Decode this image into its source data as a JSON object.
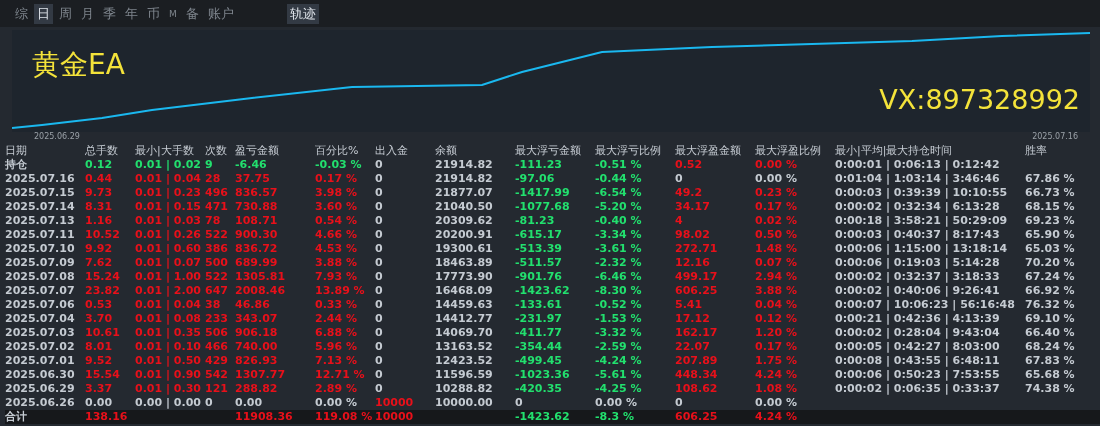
{
  "period_tabs": [
    {
      "label": "综",
      "selected": false
    },
    {
      "label": "日",
      "selected": true
    },
    {
      "label": "周",
      "selected": false
    },
    {
      "label": "月",
      "selected": false
    },
    {
      "label": "季",
      "selected": false
    },
    {
      "label": "年",
      "selected": false
    },
    {
      "label": "币",
      "selected": false
    },
    {
      "label": "M",
      "selected": false
    },
    {
      "label": "备",
      "selected": false
    },
    {
      "label": "账户",
      "selected": false
    }
  ],
  "view_tabs": [
    {
      "label": "轨迹",
      "selected": true
    }
  ],
  "chart": {
    "title": "黄金EA",
    "contact": "VX:897328992",
    "start_date": "2025.06.29",
    "end_date": "2025.07.16"
  },
  "table": {
    "columns": [
      "日期",
      "总手数",
      "最小|大手数",
      "次数",
      "盈亏金额",
      "百分比%",
      "出入金",
      "余额",
      "最大浮亏金额",
      "最大浮亏比例",
      "最大浮盈金额",
      "最大浮盈比例",
      "最小|平均|最大持仓时间",
      "胜率"
    ],
    "rows": [
      {
        "kind": "open",
        "cells": [
          {
            "text": "持仓",
            "color": "#c5cbd2"
          },
          {
            "text": "0.12",
            "color": "#22e06e"
          },
          {
            "text": "0.01 | 0.02",
            "color": "#22e06e"
          },
          {
            "text": "9",
            "color": "#22e06e"
          },
          {
            "text": "-6.46",
            "color": "#22e06e"
          },
          {
            "text": "-0.03 %",
            "color": "#22e06e"
          },
          {
            "text": "0",
            "color": "#c5cbd2"
          },
          {
            "text": "21914.82",
            "color": "#c5cbd2"
          },
          {
            "text": "-111.23",
            "color": "#22e06e"
          },
          {
            "text": "-0.51 %",
            "color": "#22e06e"
          },
          {
            "text": "0.52",
            "color": "#e8101a"
          },
          {
            "text": "0.00 %",
            "color": "#e8101a"
          },
          {
            "text": "0:00:01 | 0:06:13 | 0:12:42",
            "color": "#c5cbd2"
          }
        ]
      },
      {
        "kind": "day",
        "cells": [
          {
            "text": "2025.07.16",
            "color": "#c5cbd2"
          },
          {
            "text": "0.44",
            "color": "#e8101a"
          },
          {
            "text": "0.01 | 0.04",
            "color": "#e8101a"
          },
          {
            "text": "28",
            "color": "#e8101a"
          },
          {
            "text": "37.75",
            "color": "#e8101a"
          },
          {
            "text": "0.17 %",
            "color": "#e8101a"
          },
          {
            "text": "0",
            "color": "#c5cbd2"
          },
          {
            "text": "21914.82",
            "color": "#c5cbd2"
          },
          {
            "text": "-97.06",
            "color": "#22e06e"
          },
          {
            "text": "-0.44 %",
            "color": "#22e06e"
          },
          {
            "text": "0",
            "color": "#c5cbd2"
          },
          {
            "text": "0.00 %",
            "color": "#c5cbd2"
          },
          {
            "text": "0:01:04 | 1:03:14 | 3:46:46",
            "color": "#c5cbd2"
          },
          {
            "text": "67.86 %",
            "color": "#c5cbd2"
          }
        ]
      },
      {
        "kind": "day",
        "cells": [
          {
            "text": "2025.07.15",
            "color": "#c5cbd2"
          },
          {
            "text": "9.73",
            "color": "#e8101a"
          },
          {
            "text": "0.01 | 0.23",
            "color": "#e8101a"
          },
          {
            "text": "496",
            "color": "#e8101a"
          },
          {
            "text": "836.57",
            "color": "#e8101a"
          },
          {
            "text": "3.98 %",
            "color": "#e8101a"
          },
          {
            "text": "0",
            "color": "#c5cbd2"
          },
          {
            "text": "21877.07",
            "color": "#c5cbd2"
          },
          {
            "text": "-1417.99",
            "color": "#22e06e"
          },
          {
            "text": "-6.54 %",
            "color": "#22e06e"
          },
          {
            "text": "49.2",
            "color": "#e8101a"
          },
          {
            "text": "0.23 %",
            "color": "#e8101a"
          },
          {
            "text": "0:00:03 | 0:39:39 | 10:10:55",
            "color": "#c5cbd2"
          },
          {
            "text": "66.73 %",
            "color": "#c5cbd2"
          }
        ]
      },
      {
        "kind": "day",
        "cells": [
          {
            "text": "2025.07.14",
            "color": "#c5cbd2"
          },
          {
            "text": "8.31",
            "color": "#e8101a"
          },
          {
            "text": "0.01 | 0.15",
            "color": "#e8101a"
          },
          {
            "text": "471",
            "color": "#e8101a"
          },
          {
            "text": "730.88",
            "color": "#e8101a"
          },
          {
            "text": "3.60 %",
            "color": "#e8101a"
          },
          {
            "text": "0",
            "color": "#c5cbd2"
          },
          {
            "text": "21040.50",
            "color": "#c5cbd2"
          },
          {
            "text": "-1077.68",
            "color": "#22e06e"
          },
          {
            "text": "-5.20 %",
            "color": "#22e06e"
          },
          {
            "text": "34.17",
            "color": "#e8101a"
          },
          {
            "text": "0.17 %",
            "color": "#e8101a"
          },
          {
            "text": "0:00:02 | 0:32:34 | 6:13:28",
            "color": "#c5cbd2"
          },
          {
            "text": "68.15 %",
            "color": "#c5cbd2"
          }
        ]
      },
      {
        "kind": "day",
        "cells": [
          {
            "text": "2025.07.13",
            "color": "#c5cbd2"
          },
          {
            "text": "1.16",
            "color": "#e8101a"
          },
          {
            "text": "0.01 | 0.03",
            "color": "#e8101a"
          },
          {
            "text": "78",
            "color": "#e8101a"
          },
          {
            "text": "108.71",
            "color": "#e8101a"
          },
          {
            "text": "0.54 %",
            "color": "#e8101a"
          },
          {
            "text": "0",
            "color": "#c5cbd2"
          },
          {
            "text": "20309.62",
            "color": "#c5cbd2"
          },
          {
            "text": "-81.23",
            "color": "#22e06e"
          },
          {
            "text": "-0.40 %",
            "color": "#22e06e"
          },
          {
            "text": "4",
            "color": "#e8101a"
          },
          {
            "text": "0.02 %",
            "color": "#e8101a"
          },
          {
            "text": "0:00:18 | 3:58:21 | 50:29:09",
            "color": "#c5cbd2"
          },
          {
            "text": "69.23 %",
            "color": "#c5cbd2"
          }
        ]
      },
      {
        "kind": "day",
        "cells": [
          {
            "text": "2025.07.11",
            "color": "#c5cbd2"
          },
          {
            "text": "10.52",
            "color": "#e8101a"
          },
          {
            "text": "0.01 | 0.26",
            "color": "#e8101a"
          },
          {
            "text": "522",
            "color": "#e8101a"
          },
          {
            "text": "900.30",
            "color": "#e8101a"
          },
          {
            "text": "4.66 %",
            "color": "#e8101a"
          },
          {
            "text": "0",
            "color": "#c5cbd2"
          },
          {
            "text": "20200.91",
            "color": "#c5cbd2"
          },
          {
            "text": "-615.17",
            "color": "#22e06e"
          },
          {
            "text": "-3.34 %",
            "color": "#22e06e"
          },
          {
            "text": "98.02",
            "color": "#e8101a"
          },
          {
            "text": "0.50 %",
            "color": "#e8101a"
          },
          {
            "text": "0:00:03 | 0:40:37 | 8:17:43",
            "color": "#c5cbd2"
          },
          {
            "text": "65.90 %",
            "color": "#c5cbd2"
          }
        ]
      },
      {
        "kind": "day",
        "cells": [
          {
            "text": "2025.07.10",
            "color": "#c5cbd2"
          },
          {
            "text": "9.92",
            "color": "#e8101a"
          },
          {
            "text": "0.01 | 0.60",
            "color": "#e8101a"
          },
          {
            "text": "386",
            "color": "#e8101a"
          },
          {
            "text": "836.72",
            "color": "#e8101a"
          },
          {
            "text": "4.53 %",
            "color": "#e8101a"
          },
          {
            "text": "0",
            "color": "#c5cbd2"
          },
          {
            "text": "19300.61",
            "color": "#c5cbd2"
          },
          {
            "text": "-513.39",
            "color": "#22e06e"
          },
          {
            "text": "-3.61 %",
            "color": "#22e06e"
          },
          {
            "text": "272.71",
            "color": "#e8101a"
          },
          {
            "text": "1.48 %",
            "color": "#e8101a"
          },
          {
            "text": "0:00:06 | 1:15:00 | 13:18:14",
            "color": "#c5cbd2"
          },
          {
            "text": "65.03 %",
            "color": "#c5cbd2"
          }
        ]
      },
      {
        "kind": "day",
        "cells": [
          {
            "text": "2025.07.09",
            "color": "#c5cbd2"
          },
          {
            "text": "7.62",
            "color": "#e8101a"
          },
          {
            "text": "0.01 | 0.07",
            "color": "#e8101a"
          },
          {
            "text": "500",
            "color": "#e8101a"
          },
          {
            "text": "689.99",
            "color": "#e8101a"
          },
          {
            "text": "3.88 %",
            "color": "#e8101a"
          },
          {
            "text": "0",
            "color": "#c5cbd2"
          },
          {
            "text": "18463.89",
            "color": "#c5cbd2"
          },
          {
            "text": "-511.57",
            "color": "#22e06e"
          },
          {
            "text": "-2.32 %",
            "color": "#22e06e"
          },
          {
            "text": "12.16",
            "color": "#e8101a"
          },
          {
            "text": "0.07 %",
            "color": "#e8101a"
          },
          {
            "text": "0:00:06 | 0:19:03 | 5:14:28",
            "color": "#c5cbd2"
          },
          {
            "text": "70.20 %",
            "color": "#c5cbd2"
          }
        ]
      },
      {
        "kind": "day",
        "cells": [
          {
            "text": "2025.07.08",
            "color": "#c5cbd2"
          },
          {
            "text": "15.24",
            "color": "#e8101a"
          },
          {
            "text": "0.01 | 1.00",
            "color": "#e8101a"
          },
          {
            "text": "522",
            "color": "#e8101a"
          },
          {
            "text": "1305.81",
            "color": "#e8101a"
          },
          {
            "text": "7.93 %",
            "color": "#e8101a"
          },
          {
            "text": "0",
            "color": "#c5cbd2"
          },
          {
            "text": "17773.90",
            "color": "#c5cbd2"
          },
          {
            "text": "-901.76",
            "color": "#22e06e"
          },
          {
            "text": "-6.46 %",
            "color": "#22e06e"
          },
          {
            "text": "499.17",
            "color": "#e8101a"
          },
          {
            "text": "2.94 %",
            "color": "#e8101a"
          },
          {
            "text": "0:00:02 | 0:32:37 | 3:18:33",
            "color": "#c5cbd2"
          },
          {
            "text": "67.24 %",
            "color": "#c5cbd2"
          }
        ]
      },
      {
        "kind": "day",
        "cells": [
          {
            "text": "2025.07.07",
            "color": "#c5cbd2"
          },
          {
            "text": "23.82",
            "color": "#e8101a"
          },
          {
            "text": "0.01 | 2.00",
            "color": "#e8101a"
          },
          {
            "text": "647",
            "color": "#e8101a"
          },
          {
            "text": "2008.46",
            "color": "#e8101a"
          },
          {
            "text": "13.89 %",
            "color": "#e8101a"
          },
          {
            "text": "0",
            "color": "#c5cbd2"
          },
          {
            "text": "16468.09",
            "color": "#c5cbd2"
          },
          {
            "text": "-1423.62",
            "color": "#22e06e"
          },
          {
            "text": "-8.30 %",
            "color": "#22e06e"
          },
          {
            "text": "606.25",
            "color": "#e8101a"
          },
          {
            "text": "3.88 %",
            "color": "#e8101a"
          },
          {
            "text": "0:00:02 | 0:40:06 | 9:26:41",
            "color": "#c5cbd2"
          },
          {
            "text": "66.92 %",
            "color": "#c5cbd2"
          }
        ]
      },
      {
        "kind": "day",
        "cells": [
          {
            "text": "2025.07.06",
            "color": "#c5cbd2"
          },
          {
            "text": "0.53",
            "color": "#e8101a"
          },
          {
            "text": "0.01 | 0.04",
            "color": "#e8101a"
          },
          {
            "text": "38",
            "color": "#e8101a"
          },
          {
            "text": "46.86",
            "color": "#e8101a"
          },
          {
            "text": "0.33 %",
            "color": "#e8101a"
          },
          {
            "text": "0",
            "color": "#c5cbd2"
          },
          {
            "text": "14459.63",
            "color": "#c5cbd2"
          },
          {
            "text": "-133.61",
            "color": "#22e06e"
          },
          {
            "text": "-0.52 %",
            "color": "#22e06e"
          },
          {
            "text": "5.41",
            "color": "#e8101a"
          },
          {
            "text": "0.04 %",
            "color": "#e8101a"
          },
          {
            "text": "0:00:07 | 10:06:23 | 56:16:48",
            "color": "#c5cbd2"
          },
          {
            "text": "76.32 %",
            "color": "#c5cbd2"
          }
        ]
      },
      {
        "kind": "day",
        "cells": [
          {
            "text": "2025.07.04",
            "color": "#c5cbd2"
          },
          {
            "text": "3.70",
            "color": "#e8101a"
          },
          {
            "text": "0.01 | 0.08",
            "color": "#e8101a"
          },
          {
            "text": "233",
            "color": "#e8101a"
          },
          {
            "text": "343.07",
            "color": "#e8101a"
          },
          {
            "text": "2.44 %",
            "color": "#e8101a"
          },
          {
            "text": "0",
            "color": "#c5cbd2"
          },
          {
            "text": "14412.77",
            "color": "#c5cbd2"
          },
          {
            "text": "-231.97",
            "color": "#22e06e"
          },
          {
            "text": "-1.53 %",
            "color": "#22e06e"
          },
          {
            "text": "17.12",
            "color": "#e8101a"
          },
          {
            "text": "0.12 %",
            "color": "#e8101a"
          },
          {
            "text": "0:00:21 | 0:42:36 | 4:13:39",
            "color": "#c5cbd2"
          },
          {
            "text": "69.10 %",
            "color": "#c5cbd2"
          }
        ]
      },
      {
        "kind": "day",
        "cells": [
          {
            "text": "2025.07.03",
            "color": "#c5cbd2"
          },
          {
            "text": "10.61",
            "color": "#e8101a"
          },
          {
            "text": "0.01 | 0.35",
            "color": "#e8101a"
          },
          {
            "text": "506",
            "color": "#e8101a"
          },
          {
            "text": "906.18",
            "color": "#e8101a"
          },
          {
            "text": "6.88 %",
            "color": "#e8101a"
          },
          {
            "text": "0",
            "color": "#c5cbd2"
          },
          {
            "text": "14069.70",
            "color": "#c5cbd2"
          },
          {
            "text": "-411.77",
            "color": "#22e06e"
          },
          {
            "text": "-3.32 %",
            "color": "#22e06e"
          },
          {
            "text": "162.17",
            "color": "#e8101a"
          },
          {
            "text": "1.20 %",
            "color": "#e8101a"
          },
          {
            "text": "0:00:02 | 0:28:04 | 9:43:04",
            "color": "#c5cbd2"
          },
          {
            "text": "66.40 %",
            "color": "#c5cbd2"
          }
        ]
      },
      {
        "kind": "day",
        "cells": [
          {
            "text": "2025.07.02",
            "color": "#c5cbd2"
          },
          {
            "text": "8.01",
            "color": "#e8101a"
          },
          {
            "text": "0.01 | 0.10",
            "color": "#e8101a"
          },
          {
            "text": "466",
            "color": "#e8101a"
          },
          {
            "text": "740.00",
            "color": "#e8101a"
          },
          {
            "text": "5.96 %",
            "color": "#e8101a"
          },
          {
            "text": "0",
            "color": "#c5cbd2"
          },
          {
            "text": "13163.52",
            "color": "#c5cbd2"
          },
          {
            "text": "-354.44",
            "color": "#22e06e"
          },
          {
            "text": "-2.59 %",
            "color": "#22e06e"
          },
          {
            "text": "22.07",
            "color": "#e8101a"
          },
          {
            "text": "0.17 %",
            "color": "#e8101a"
          },
          {
            "text": "0:00:05 | 0:42:27 | 8:03:00",
            "color": "#c5cbd2"
          },
          {
            "text": "68.24 %",
            "color": "#c5cbd2"
          }
        ]
      },
      {
        "kind": "day",
        "cells": [
          {
            "text": "2025.07.01",
            "color": "#c5cbd2"
          },
          {
            "text": "9.52",
            "color": "#e8101a"
          },
          {
            "text": "0.01 | 0.50",
            "color": "#e8101a"
          },
          {
            "text": "429",
            "color": "#e8101a"
          },
          {
            "text": "826.93",
            "color": "#e8101a"
          },
          {
            "text": "7.13 %",
            "color": "#e8101a"
          },
          {
            "text": "0",
            "color": "#c5cbd2"
          },
          {
            "text": "12423.52",
            "color": "#c5cbd2"
          },
          {
            "text": "-499.45",
            "color": "#22e06e"
          },
          {
            "text": "-4.24 %",
            "color": "#22e06e"
          },
          {
            "text": "207.89",
            "color": "#e8101a"
          },
          {
            "text": "1.75 %",
            "color": "#e8101a"
          },
          {
            "text": "0:00:08 | 0:43:55 | 6:48:11",
            "color": "#c5cbd2"
          },
          {
            "text": "67.83 %",
            "color": "#c5cbd2"
          }
        ]
      },
      {
        "kind": "day",
        "cells": [
          {
            "text": "2025.06.30",
            "color": "#c5cbd2"
          },
          {
            "text": "15.54",
            "color": "#e8101a"
          },
          {
            "text": "0.01 | 0.90",
            "color": "#e8101a"
          },
          {
            "text": "542",
            "color": "#e8101a"
          },
          {
            "text": "1307.77",
            "color": "#e8101a"
          },
          {
            "text": "12.71 %",
            "color": "#e8101a"
          },
          {
            "text": "0",
            "color": "#c5cbd2"
          },
          {
            "text": "11596.59",
            "color": "#c5cbd2"
          },
          {
            "text": "-1023.36",
            "color": "#22e06e"
          },
          {
            "text": "-5.61 %",
            "color": "#22e06e"
          },
          {
            "text": "448.34",
            "color": "#e8101a"
          },
          {
            "text": "4.24 %",
            "color": "#e8101a"
          },
          {
            "text": "0:00:06 | 0:50:23 | 7:53:55",
            "color": "#c5cbd2"
          },
          {
            "text": "65.68 %",
            "color": "#c5cbd2"
          }
        ]
      },
      {
        "kind": "day",
        "cells": [
          {
            "text": "2025.06.29",
            "color": "#c5cbd2"
          },
          {
            "text": "3.37",
            "color": "#e8101a"
          },
          {
            "text": "0.01 | 0.30",
            "color": "#e8101a"
          },
          {
            "text": "121",
            "color": "#e8101a"
          },
          {
            "text": "288.82",
            "color": "#e8101a"
          },
          {
            "text": "2.89 %",
            "color": "#e8101a"
          },
          {
            "text": "0",
            "color": "#c5cbd2"
          },
          {
            "text": "10288.82",
            "color": "#c5cbd2"
          },
          {
            "text": "-420.35",
            "color": "#22e06e"
          },
          {
            "text": "-4.25 %",
            "color": "#22e06e"
          },
          {
            "text": "108.62",
            "color": "#e8101a"
          },
          {
            "text": "1.08 %",
            "color": "#e8101a"
          },
          {
            "text": "0:00:02 | 0:06:35 | 0:33:37",
            "color": "#c5cbd2"
          },
          {
            "text": "74.38 %",
            "color": "#c5cbd2"
          }
        ]
      },
      {
        "kind": "day",
        "cells": [
          {
            "text": "2025.06.26",
            "color": "#c5cbd2"
          },
          {
            "text": "0.00",
            "color": "#c5cbd2"
          },
          {
            "text": "0.00 | 0.00",
            "color": "#c5cbd2"
          },
          {
            "text": "0",
            "color": "#c5cbd2"
          },
          {
            "text": "0.00",
            "color": "#c5cbd2"
          },
          {
            "text": "0.00 %",
            "color": "#c5cbd2"
          },
          {
            "text": "10000",
            "color": "#e8101a"
          },
          {
            "text": "10000.00",
            "color": "#c5cbd2"
          },
          {
            "text": "0",
            "color": "#c5cbd2"
          },
          {
            "text": "0.00 %",
            "color": "#c5cbd2"
          },
          {
            "text": "0",
            "color": "#c5cbd2"
          },
          {
            "text": "0.00 %",
            "color": "#c5cbd2"
          }
        ]
      },
      {
        "kind": "total",
        "cells": [
          {
            "text": "合计",
            "color": "#c5cbd2"
          },
          {
            "text": "138.16",
            "color": "#e8101a"
          },
          null,
          null,
          {
            "text": "11908.36",
            "color": "#e8101a"
          },
          {
            "text": "119.08 %",
            "color": "#e8101a"
          },
          {
            "text": "10000",
            "color": "#e8101a"
          },
          null,
          {
            "text": "-1423.62",
            "color": "#22e06e"
          },
          {
            "text": "-8.3 %",
            "color": "#22e06e"
          },
          {
            "text": "606.25",
            "color": "#e8101a"
          },
          {
            "text": "4.24 %",
            "color": "#e8101a"
          }
        ]
      }
    ]
  }
}
